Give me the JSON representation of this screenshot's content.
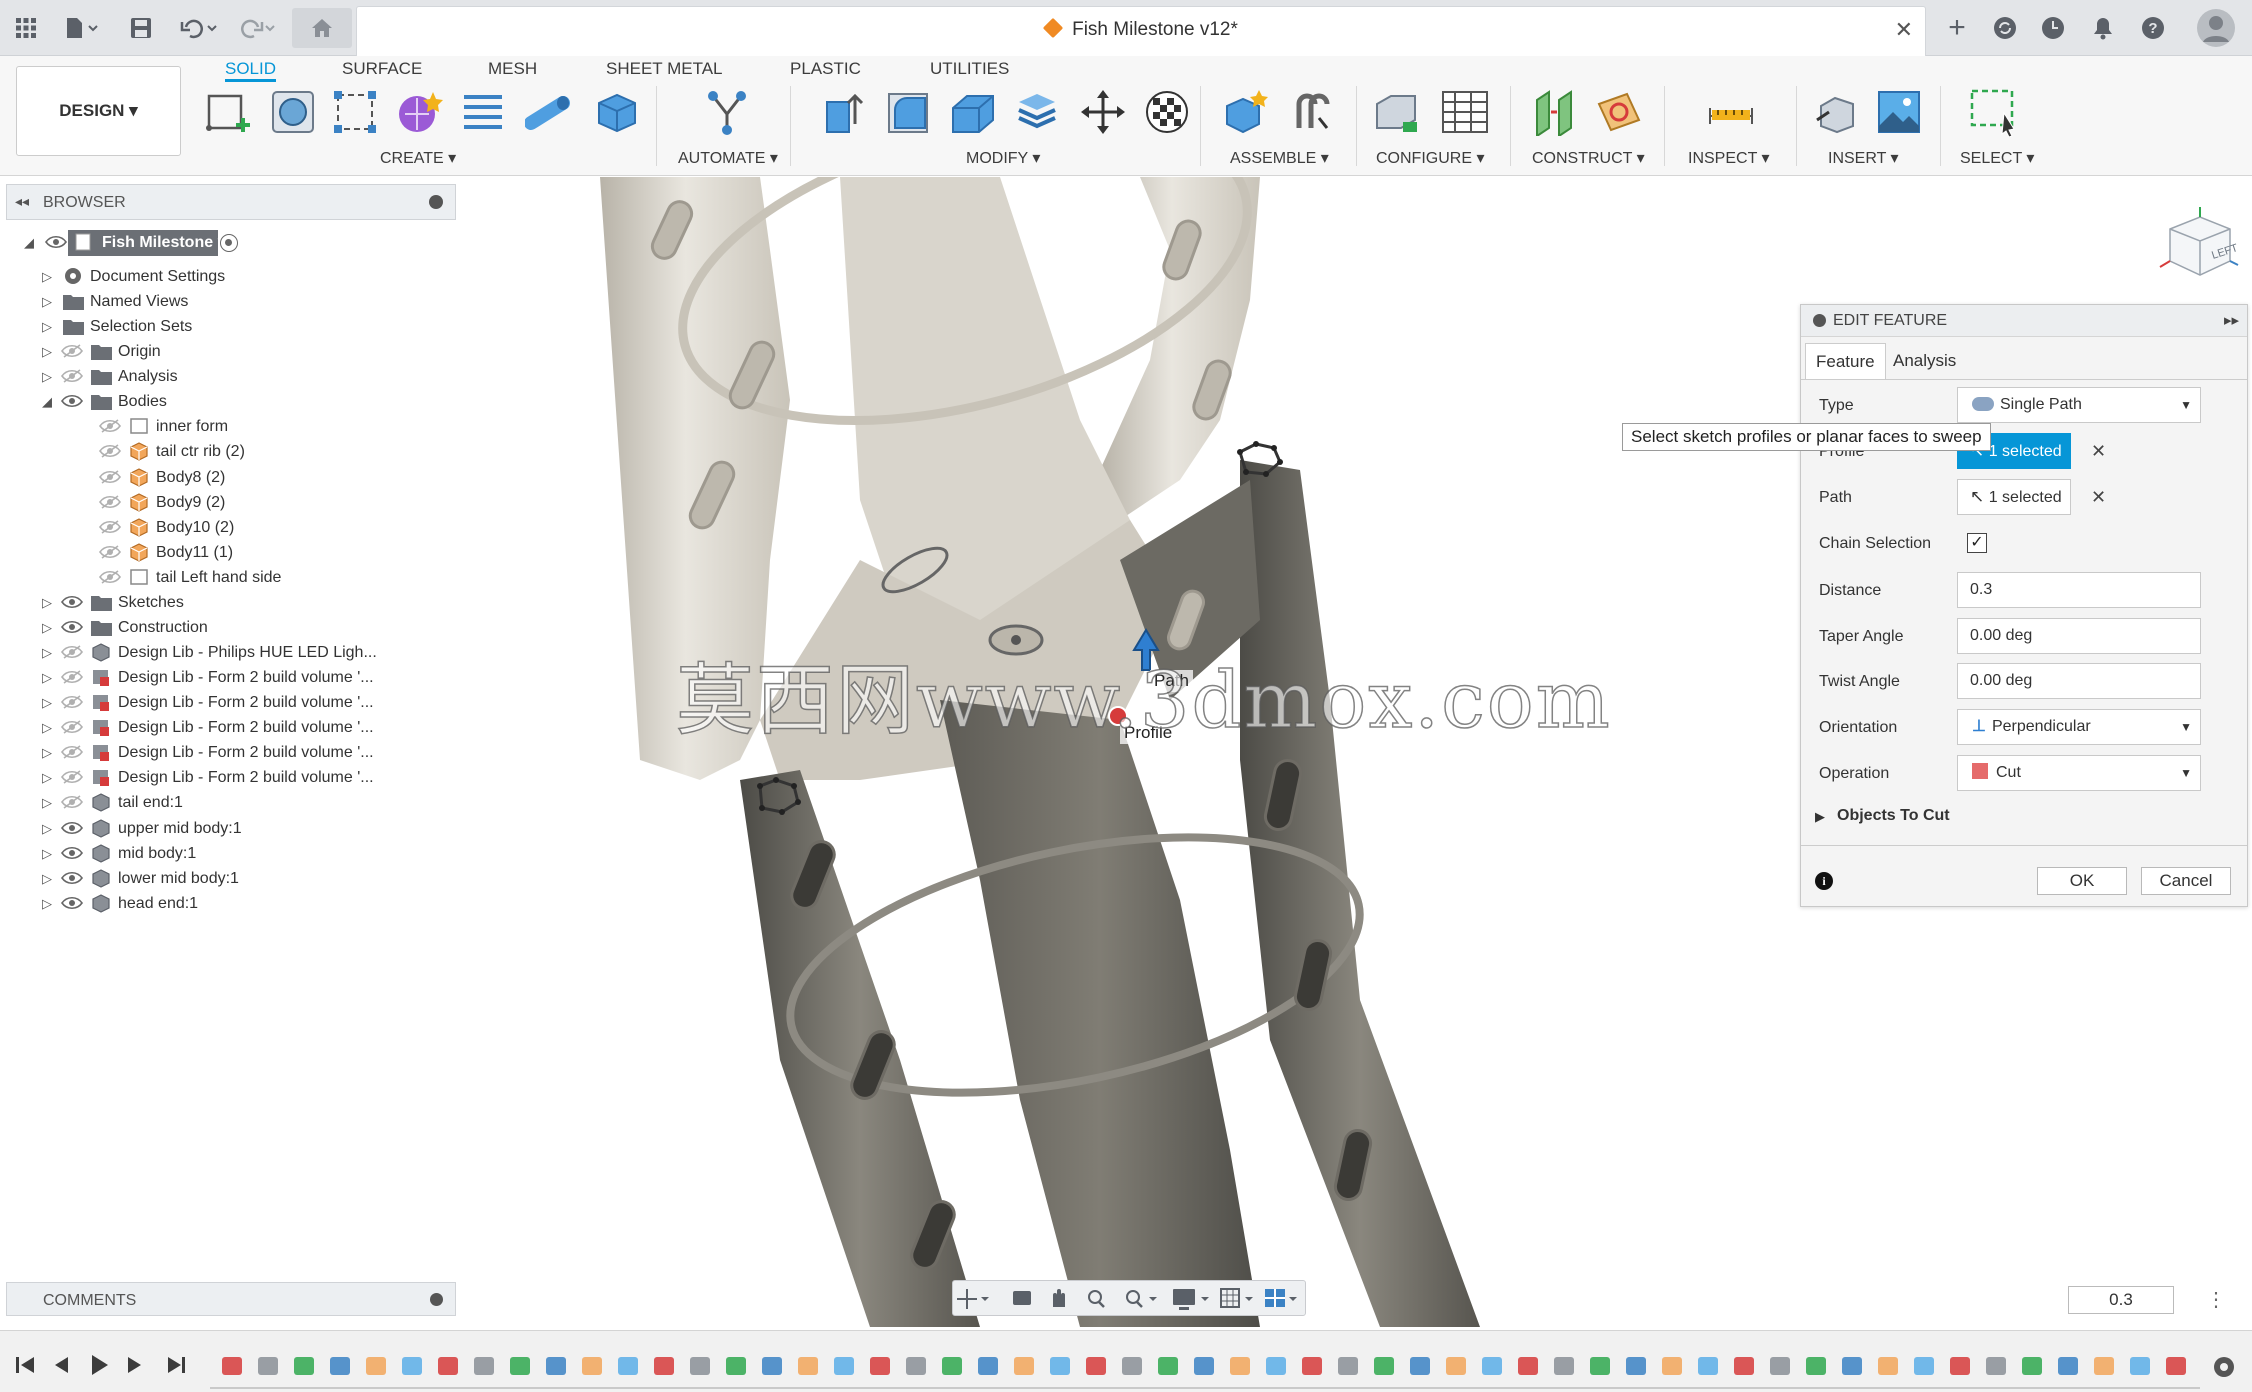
{
  "window": {
    "document_title": "Fish Milestone v12*"
  },
  "ribbon": {
    "workspace_button": "DESIGN ▾",
    "tabs": [
      "SOLID",
      "SURFACE",
      "MESH",
      "SHEET METAL",
      "PLASTIC",
      "UTILITIES"
    ],
    "active_tab": "SOLID",
    "groups": [
      "CREATE ▾",
      "AUTOMATE ▾",
      "MODIFY ▾",
      "ASSEMBLE ▾",
      "CONFIGURE ▾",
      "CONSTRUCT ▾",
      "INSPECT ▾",
      "INSERT ▾",
      "SELECT ▾"
    ]
  },
  "browser": {
    "title": "BROWSER",
    "root": "Fish Milestone v12",
    "items": [
      "Document Settings",
      "Named Views",
      "Selection Sets",
      "Origin",
      "Analysis",
      "Bodies",
      "inner form",
      "tail ctr rib (2)",
      "Body8 (2)",
      "Body9 (2)",
      "Body10 (2)",
      "Body11 (1)",
      "tail Left hand side",
      "Sketches",
      "Construction",
      "Design Lib - Philips HUE LED Ligh...",
      "Design Lib - Form 2 build volume '...",
      "Design Lib - Form 2 build volume '...",
      "Design Lib - Form 2 build volume '...",
      "Design Lib - Form 2 build volume '...",
      "Design Lib - Form 2 build volume '...",
      "tail end:1",
      "upper mid body:1",
      "mid body:1",
      "lower mid body:1",
      "head end:1"
    ]
  },
  "edit_feature": {
    "title": "EDIT FEATURE",
    "tabs": [
      "Feature",
      "Analysis"
    ],
    "rows": {
      "type_label": "Type",
      "type_value": "Single Path",
      "profile_label": "Profile",
      "profile_value": "1 selected",
      "path_label": "Path",
      "path_value": "1 selected",
      "chain_label": "Chain Selection",
      "distance_label": "Distance",
      "distance_value": "0.3",
      "taper_label": "Taper Angle",
      "taper_value": "0.00 deg",
      "twist_label": "Twist Angle",
      "twist_value": "0.00 deg",
      "orientation_label": "Orientation",
      "orientation_value": "Perpendicular",
      "operation_label": "Operation",
      "operation_value": "Cut",
      "objects_label": "Objects To Cut"
    },
    "ok": "OK",
    "cancel": "Cancel",
    "chain_checked": true
  },
  "tooltip": "Select sketch profiles or planar faces to sweep",
  "viewport": {
    "watermark": "莫西网www.3dmox.com",
    "label_path": "Path",
    "label_profile": "Profile",
    "viewcube_face": "LEFT"
  },
  "comments": {
    "title": "COMMENTS"
  },
  "zoom_value": "0.3",
  "colors": {
    "accent": "#0696d7",
    "orange": "#f08a23"
  }
}
